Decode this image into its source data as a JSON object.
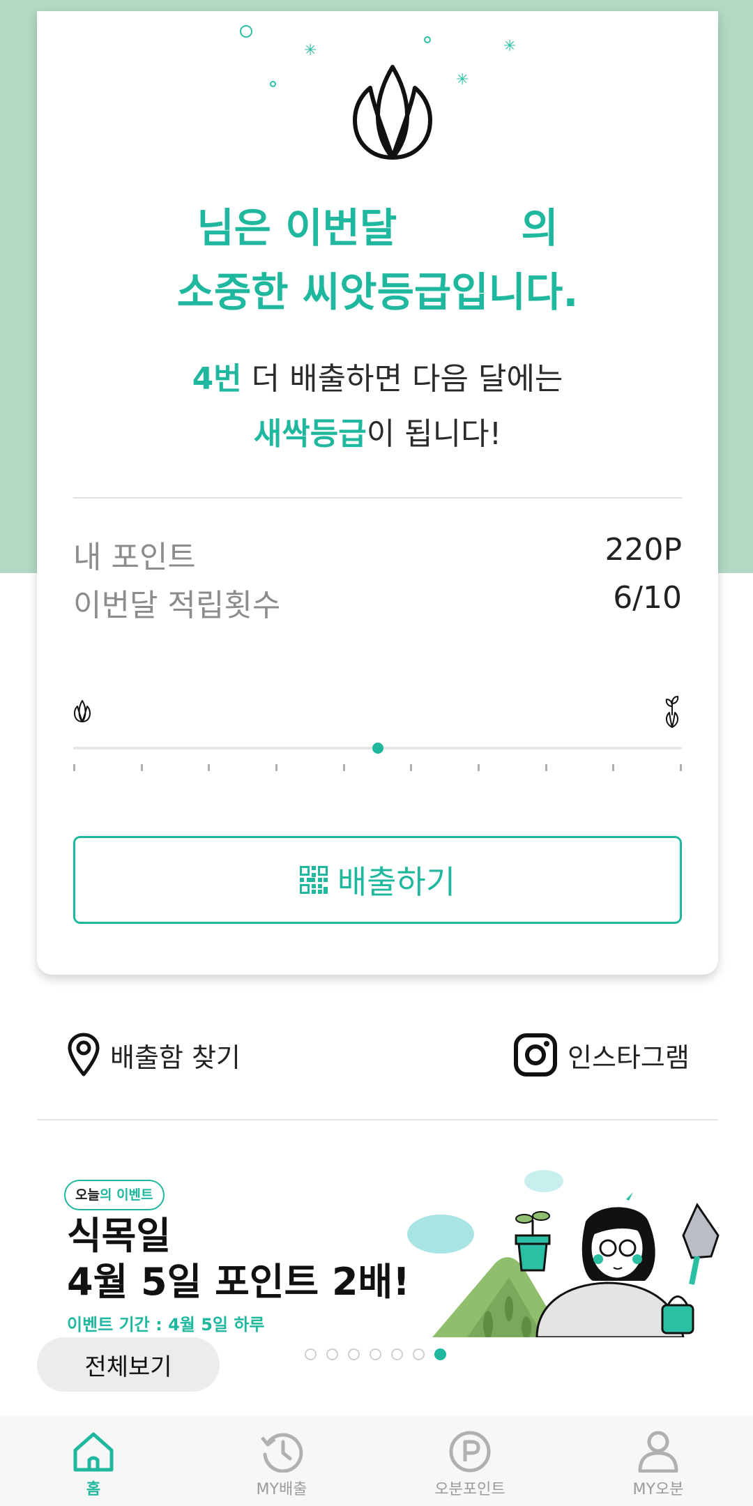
{
  "grade_card": {
    "title_line1": "님은 이번달",
    "title_suffix": "의",
    "title_line2": "소중한 씨앗등급입니다.",
    "message_count": "4번",
    "message_line1_rest": " 더 배출하면 다음 달에는",
    "message_next_grade": "새싹등급",
    "message_line2_rest": "이 됩니다!",
    "points_label": "내 포인트",
    "points_value": "220P",
    "count_label": "이번달 적립횟수",
    "count_value": "6/10",
    "progress_fraction": 0.5,
    "discharge_button_label": "배출하기"
  },
  "quick_links": {
    "find_bin_label": "배출함 찾기",
    "instagram_label": "인스타그램"
  },
  "event_banner": {
    "badge_part1": "오늘",
    "badge_part2": "의 이벤트",
    "title_line1": "식목일",
    "title_line2": "4월 5일 포인트 2배!",
    "period": "이벤트 기간 : 4월 5일 하루",
    "view_all_label": "전체보기",
    "page_count": 7,
    "active_page": 7
  },
  "tab_bar": {
    "tabs": [
      {
        "label": "홈",
        "icon": "home-icon",
        "active": true
      },
      {
        "label": "MY배출",
        "icon": "history-icon",
        "active": false
      },
      {
        "label": "오분포인트",
        "icon": "point-icon",
        "active": false
      },
      {
        "label": "MY오분",
        "icon": "person-icon",
        "active": false
      }
    ]
  },
  "colors": {
    "accent": "#1fb89f",
    "band": "#b2d9c4"
  }
}
